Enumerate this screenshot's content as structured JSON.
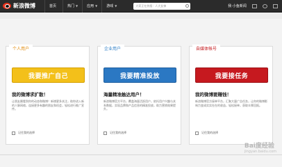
{
  "nav": {
    "logo": "新浪微博",
    "home": "首页",
    "hot": "热门",
    "apps": "应用",
    "games": "游戏",
    "search_placeholder": "大家正在热搜：人大女神",
    "user": "我·小鱼新闻"
  },
  "cards": [
    {
      "tab": "个人用户",
      "button": "我要推广自己",
      "headline": "我的微博求扩散！",
      "desc": "让朋友圈看到你的动态和微博！新增更多关注，助你进入新的人脉网络，连接更多有趣的朋友和机会，轻松进行推广宣传。",
      "remember": "记住我的选择"
    },
    {
      "tab": "企业用户",
      "button": "我要精准投放",
      "headline": "海量精准触达用户！",
      "desc": "新浪微博官方平台，覆盖海量活跃用户，依托用户兴趣与关系数据，实现品牌和产品信息的精准投放，助力营销效果提升。",
      "remember": "记住我的选择"
    },
    {
      "tab": "自媒体帐号",
      "button": "我要接任务",
      "headline": "我的微博要赚钱！",
      "desc": "新浪微博官方接单平台，汇聚大量广告任务，让你的微博影响力变成实实在在的收益，轻松接单，获取丰厚回报。",
      "remember": "记住我的选择"
    }
  ],
  "watermark": {
    "main": "Bai度经验",
    "sub": "jingyan.baidu.com"
  }
}
